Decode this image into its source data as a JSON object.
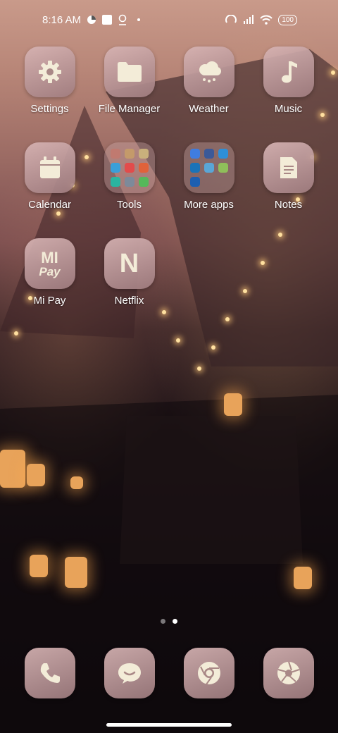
{
  "status": {
    "time": "8:16 AM",
    "battery": "100"
  },
  "apps": [
    {
      "label": "Settings",
      "icon": "gear-icon"
    },
    {
      "label": "File Manager",
      "icon": "folder-icon"
    },
    {
      "label": "Weather",
      "icon": "cloud-snow-icon"
    },
    {
      "label": "Music",
      "icon": "music-note-icon"
    },
    {
      "label": "Calendar",
      "icon": "calendar-icon"
    },
    {
      "label": "Tools",
      "icon": "folder-group-icon"
    },
    {
      "label": "More apps",
      "icon": "folder-group-icon"
    },
    {
      "label": "Notes",
      "icon": "notes-icon"
    },
    {
      "label": "Mi Pay",
      "icon": "mi-pay-icon",
      "icon_text_top": "MI",
      "icon_text_bottom": "Pay"
    },
    {
      "label": "Netflix",
      "icon": "netflix-icon",
      "icon_text": "N"
    }
  ],
  "dock": [
    {
      "label": "Phone",
      "icon": "phone-icon"
    },
    {
      "label": "Messaging",
      "icon": "message-icon"
    },
    {
      "label": "Chrome",
      "icon": "chrome-icon"
    },
    {
      "label": "Camera",
      "icon": "camera-aperture-icon"
    }
  ],
  "colors": {
    "icon_glyph": "#f3ecd8",
    "folder_minis_tools": [
      "#c07a70",
      "#c49a6a",
      "#c9b07c",
      "#3a9fd8",
      "#e24b4b",
      "#e0623a",
      "#2bb5a0",
      "#7d8a9a",
      "#55b85a"
    ],
    "folder_minis_more": [
      "#3f7de0",
      "#3b5998",
      "#2d8fd8",
      "#1a73b8",
      "#5aa6d6",
      "#8fbf5a",
      "#1d5fb0"
    ]
  },
  "pager": {
    "count": 2,
    "active": 1
  }
}
